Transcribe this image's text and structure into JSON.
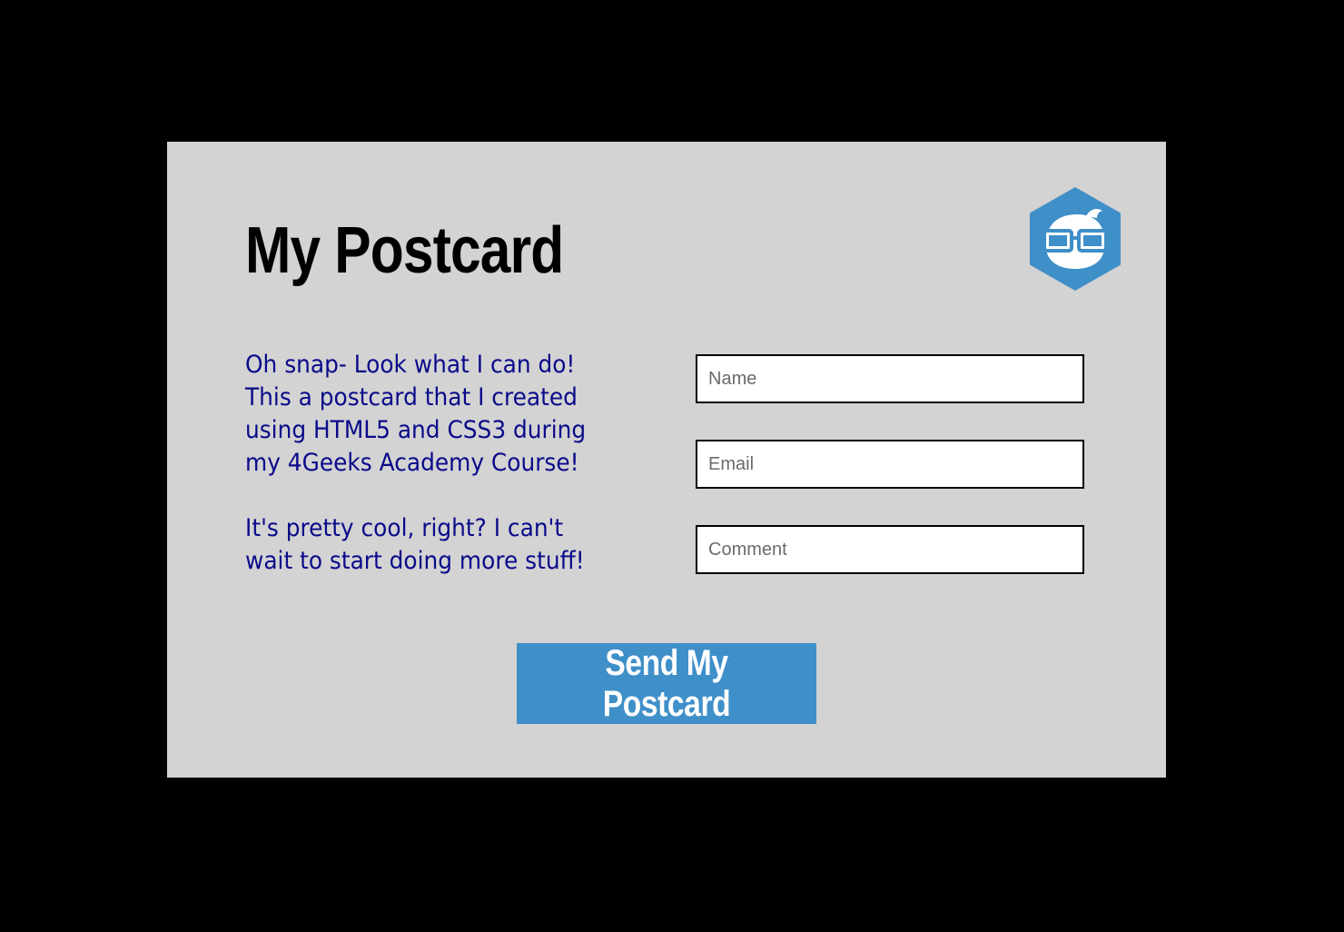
{
  "postcard": {
    "title": "My Postcard",
    "message_paragraphs": [
      "Oh snap- Look what I can do! This a postcard that I created using HTML5 and CSS3 during my 4Geeks Academy Course!",
      "It's pretty cool, right? I can't wait to start doing more stuff!"
    ],
    "logo_icon": "geek-face-hexagon-icon"
  },
  "form": {
    "name_placeholder": "Name",
    "email_placeholder": "Email",
    "comment_placeholder": "Comment",
    "submit_label": "Send My Postcard"
  },
  "colors": {
    "page_background": "#000000",
    "card_background": "#d3d3d3",
    "message_text": "#0a0a8a",
    "accent": "#3f8fc9"
  }
}
